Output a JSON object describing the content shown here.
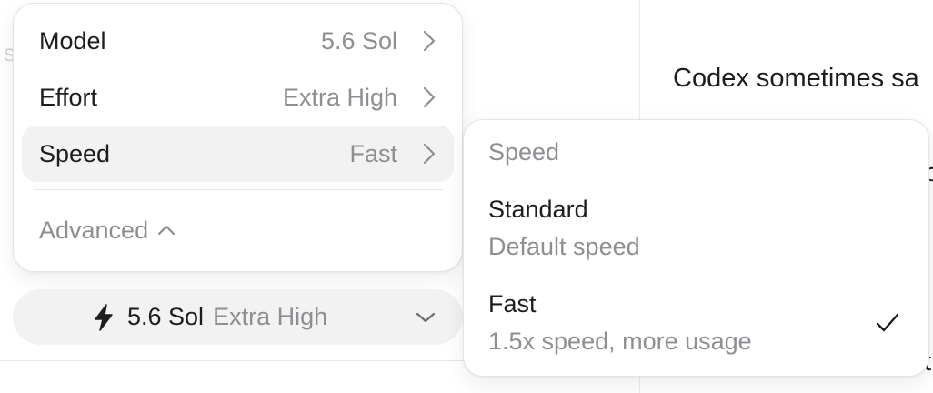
{
  "background": {
    "right_text": "Codex sometimes sa",
    "left_ghost": "s"
  },
  "menu": {
    "items": [
      {
        "label": "Model",
        "value": "5.6 Sol",
        "icon": "chevron-right-icon"
      },
      {
        "label": "Effort",
        "value": "Extra High",
        "icon": "chevron-right-icon"
      },
      {
        "label": "Speed",
        "value": "Fast",
        "icon": "chevron-right-icon",
        "active": true
      }
    ],
    "advanced_label": "Advanced",
    "advanced_icon": "chevron-up-icon"
  },
  "selector": {
    "icon": "bolt-icon",
    "model": "5.6 Sol",
    "effort": "Extra High",
    "dropdown_icon": "chevron-down-icon"
  },
  "speed_submenu": {
    "header": "Speed",
    "options": [
      {
        "title": "Standard",
        "description": "Default speed",
        "selected": false
      },
      {
        "title": "Fast",
        "description": "1.5x speed, more usage",
        "selected": true
      }
    ],
    "selected_icon": "checkmark-icon"
  },
  "colors": {
    "text_primary": "#1d1d1f",
    "text_secondary": "#8e8e93",
    "row_highlight": "#f2f2f2",
    "border": "#e4e4e4"
  }
}
